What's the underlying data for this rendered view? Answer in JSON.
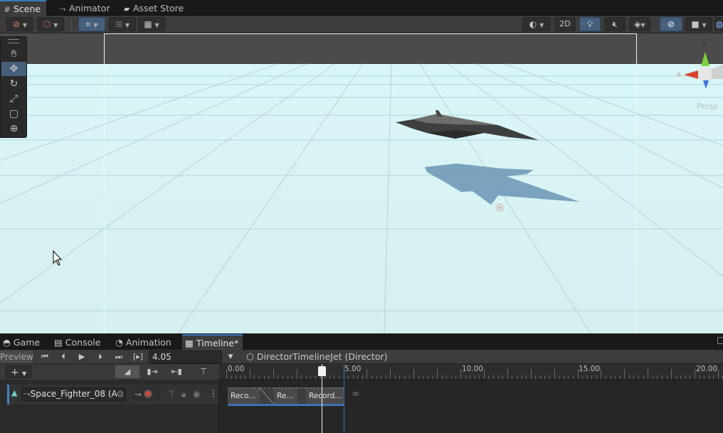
{
  "top_tabs": [
    {
      "icon": "grid-icon",
      "label": "Scene",
      "active": true
    },
    {
      "icon": "animator-icon",
      "label": "Animator",
      "active": false
    },
    {
      "icon": "bag-icon",
      "label": "Asset Store",
      "active": false
    }
  ],
  "scene_toolbar": {
    "mode_2d_label": "2D"
  },
  "gizmo": {
    "axis_y_label": "y",
    "persp_label": "Persp"
  },
  "dock_tabs": [
    {
      "label": "Game",
      "active": false
    },
    {
      "label": "Console",
      "active": false
    },
    {
      "label": "Animation",
      "active": false
    },
    {
      "label": "Timeline*",
      "active": true
    }
  ],
  "timeline": {
    "preview_label": "Preview",
    "current_time": "4.05",
    "director_label": "DirectorTimelineJet (Director)",
    "ruler_labels": [
      "0.00",
      "5.00",
      "10.00",
      "15.00",
      "20.00"
    ],
    "track_name": "Space_Fighter_08 (A",
    "clips": [
      "Reco...",
      "Re...",
      "Record..."
    ]
  },
  "colors": {
    "accent_blue": "#3a79bb",
    "record_red": "#c84b3a",
    "axis_red": "#d9432f",
    "axis_green": "#7ed23a",
    "axis_blue": "#3a74d9"
  }
}
